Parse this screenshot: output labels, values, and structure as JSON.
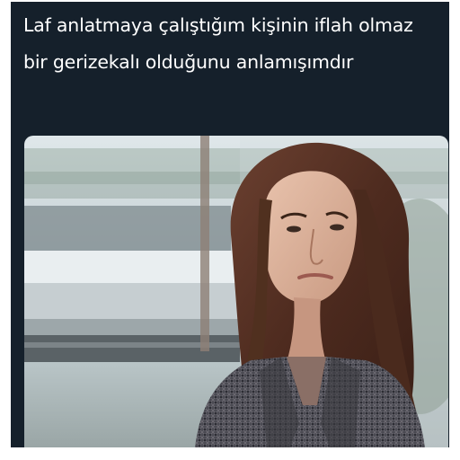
{
  "post": {
    "text": "Laf anlatmaya çalıştığım kişinin iflah olmaz bir gerizekalı olduğunu anlamışımdır"
  },
  "media": {
    "subject": "photo-of-woman-looking-sideways"
  },
  "colors": {
    "background": "#15202b",
    "text": "#ffffff",
    "outer": "#ffffff"
  }
}
